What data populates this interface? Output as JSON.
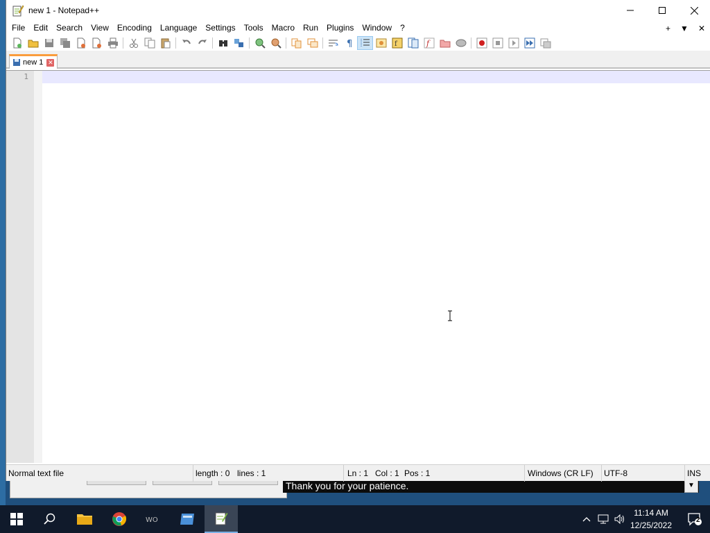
{
  "window": {
    "title": "new 1 - Notepad++"
  },
  "menu": {
    "items": [
      "File",
      "Edit",
      "Search",
      "View",
      "Encoding",
      "Language",
      "Settings",
      "Tools",
      "Macro",
      "Run",
      "Plugins",
      "Window",
      "?"
    ],
    "right": [
      "+",
      "▼",
      "✕"
    ]
  },
  "tabs": [
    {
      "label": "new 1"
    }
  ],
  "editor": {
    "line_numbers": [
      "1"
    ]
  },
  "status": {
    "file_type": "Normal text file",
    "length": "length : 0",
    "lines": "lines : 1",
    "ln": "Ln : 1",
    "col": "Col : 1",
    "pos": "Pos : 1",
    "eol": "Windows (CR LF)",
    "encoding": "UTF-8",
    "mode": "INS"
  },
  "background": {
    "message": "Thank you for your patience."
  },
  "taskbar": {
    "time": "11:14 AM",
    "date": "12/25/2022",
    "notification_count": "2"
  },
  "colors": {
    "tab_accent": "#fa9c3c",
    "current_line": "#e8e8ff",
    "taskbar": "#101a2b"
  }
}
